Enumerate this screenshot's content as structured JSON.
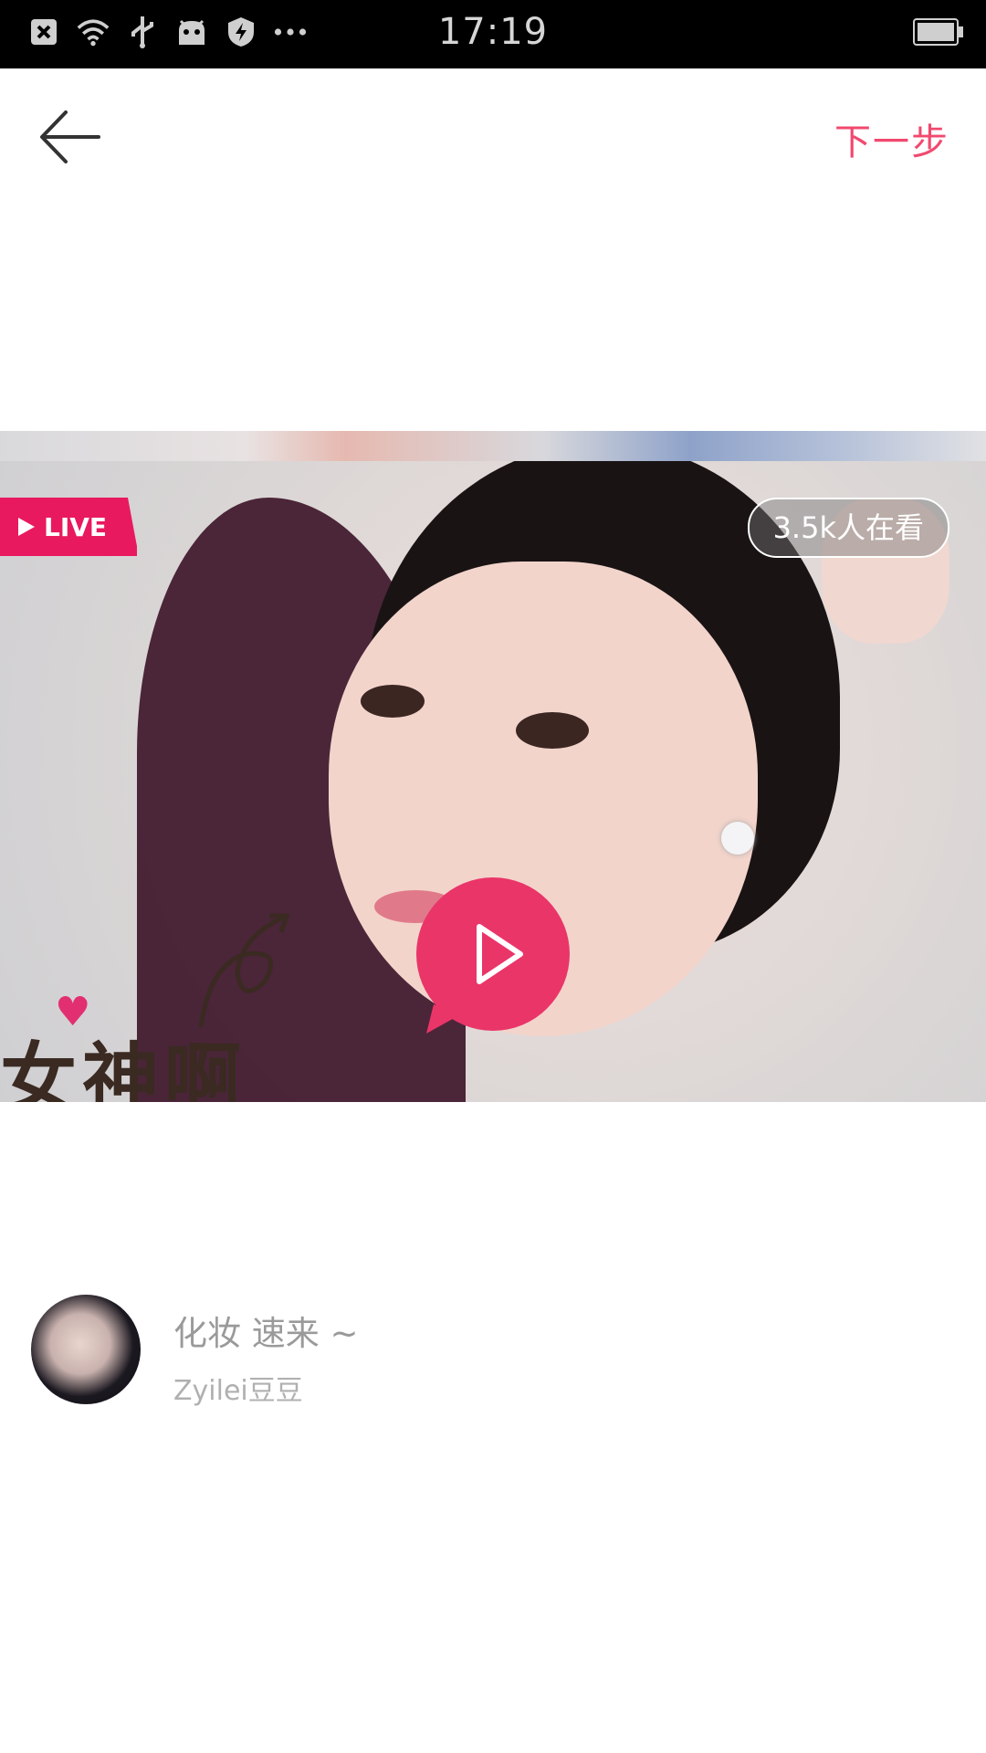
{
  "status_bar": {
    "time": "17:19",
    "icons": [
      "close-box-icon",
      "wifi-icon",
      "usb-icon",
      "android-icon",
      "shield-icon",
      "more-dots-icon"
    ],
    "battery_icon": "battery-icon"
  },
  "top_bar": {
    "back_icon": "arrow-left-icon",
    "next_label": "下一步",
    "accent_color": "#f1496f"
  },
  "cover": {
    "live_label": "LIVE",
    "viewers_label": "3.5k人在看",
    "overlay_text": "女神啊",
    "play_icon": "play-icon",
    "badge_color": "#e8195f"
  },
  "author": {
    "title": "化妆 速来 ~",
    "name": "Zyilei豆豆"
  }
}
